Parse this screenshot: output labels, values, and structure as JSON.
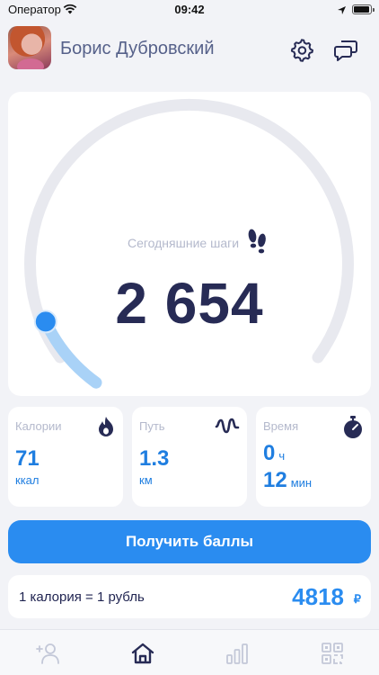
{
  "status_bar": {
    "carrier": "Оператор",
    "time": "09:42"
  },
  "header": {
    "user_name": "Борис Дубровский"
  },
  "steps": {
    "label": "Сегодняшние шаги",
    "value": "2 654",
    "progress": 0.1
  },
  "stats": {
    "calories": {
      "title": "Калории",
      "value": "71",
      "unit": "ккал"
    },
    "distance": {
      "title": "Путь",
      "value": "1.3",
      "unit": "км"
    },
    "time": {
      "title": "Время",
      "hours": "0",
      "hours_unit": "ч",
      "minutes": "12",
      "minutes_unit": "мин"
    }
  },
  "actions": {
    "get_points_label": "Получить баллы"
  },
  "rate": {
    "text": "1 калория = 1 рубль",
    "value": "4818",
    "currency": "₽"
  },
  "colors": {
    "accent": "#2a8cf0",
    "text_dark": "#272b55",
    "muted": "#b4b9cc",
    "background": "#f2f3f7"
  },
  "icons": {
    "tabs": [
      "add-friend-icon",
      "home-icon",
      "stats-icon",
      "qr-code-icon"
    ],
    "active_tab": "home-icon"
  }
}
